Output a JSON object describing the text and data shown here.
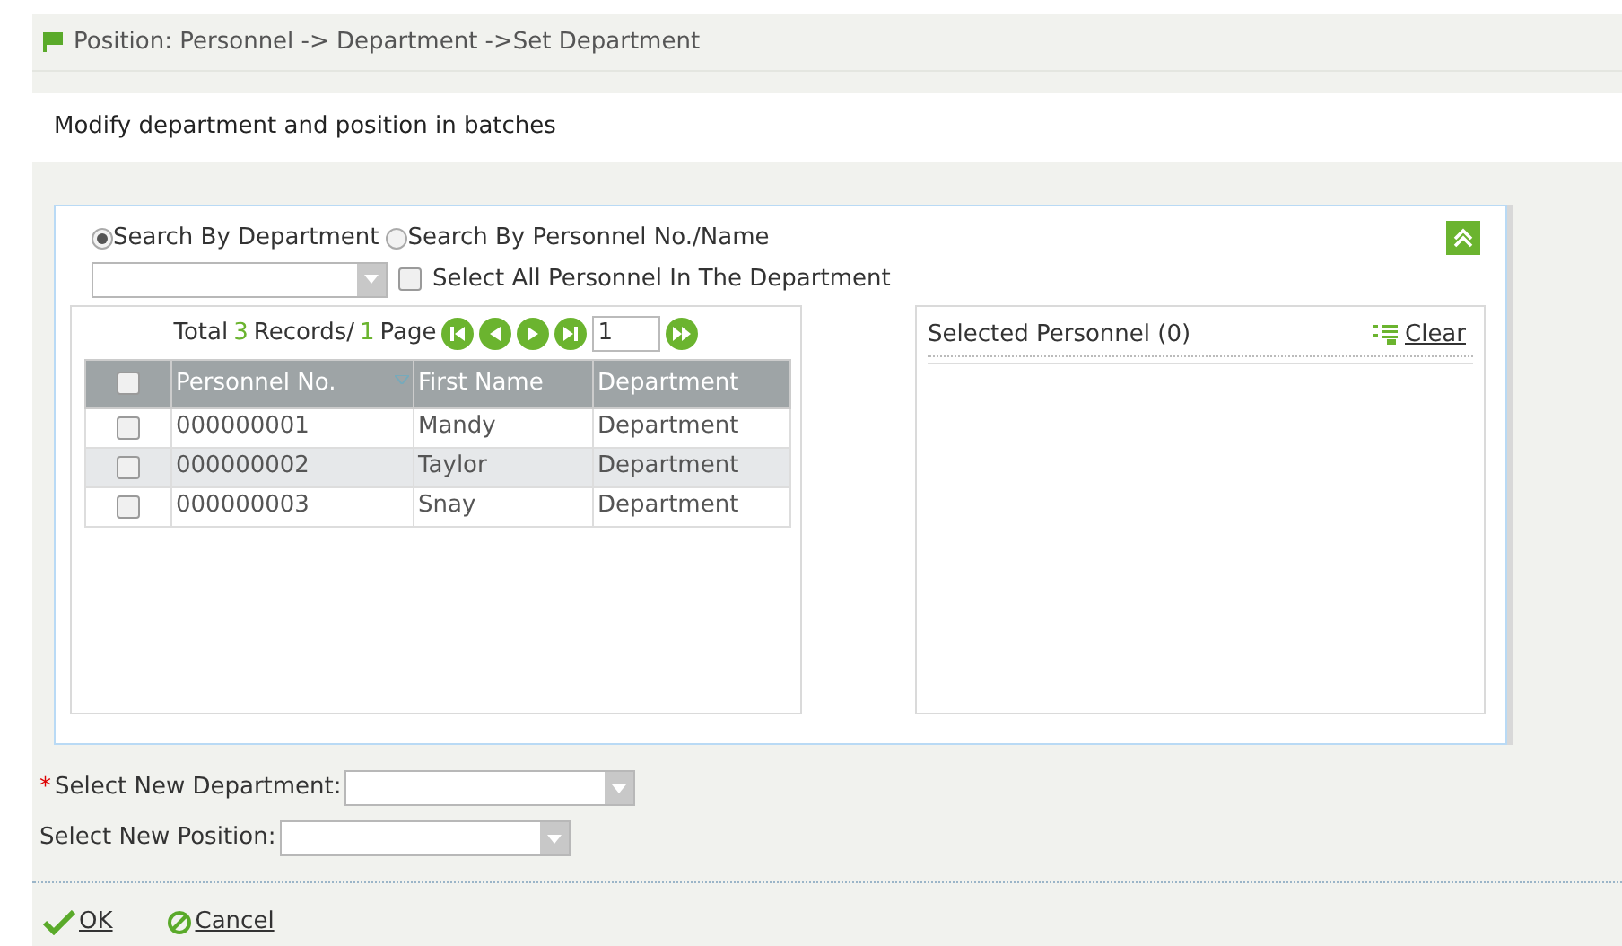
{
  "breadcrumb": "Position: Personnel -> Department ->Set Department",
  "description": "Modify department and position in batches",
  "search_modes": [
    {
      "label": "Search By Department",
      "selected": true
    },
    {
      "label": "Search By Personnel No./Name",
      "selected": false
    }
  ],
  "select_all": {
    "label": "Select All Personnel In The Department",
    "checked": false
  },
  "pager": {
    "prefix": "Total",
    "total": "3",
    "records_label": "Records/",
    "pages": "1",
    "page_label": "Page",
    "page_value": "1"
  },
  "table": {
    "columns": [
      "Personnel No.",
      "First Name",
      "Department"
    ],
    "header_checked": false,
    "rows": [
      {
        "cells": [
          "000000001",
          "Mandy",
          "Department"
        ],
        "checked": false,
        "selected": false
      },
      {
        "cells": [
          "000000002",
          "Taylor",
          "Department"
        ],
        "checked": false,
        "selected": true
      },
      {
        "cells": [
          "000000003",
          "Snay",
          "Department"
        ],
        "checked": false,
        "selected": false
      }
    ]
  },
  "selected_panel": {
    "title": "Selected Personnel (0)",
    "clear": "Clear"
  },
  "fields": [
    {
      "label": "Select New Department:",
      "required_mark": "*"
    },
    {
      "label": "Select New Position:"
    }
  ],
  "buttons": [
    {
      "kind": "ok",
      "label": "OK"
    },
    {
      "kind": "cancel",
      "label": "Cancel"
    }
  ]
}
